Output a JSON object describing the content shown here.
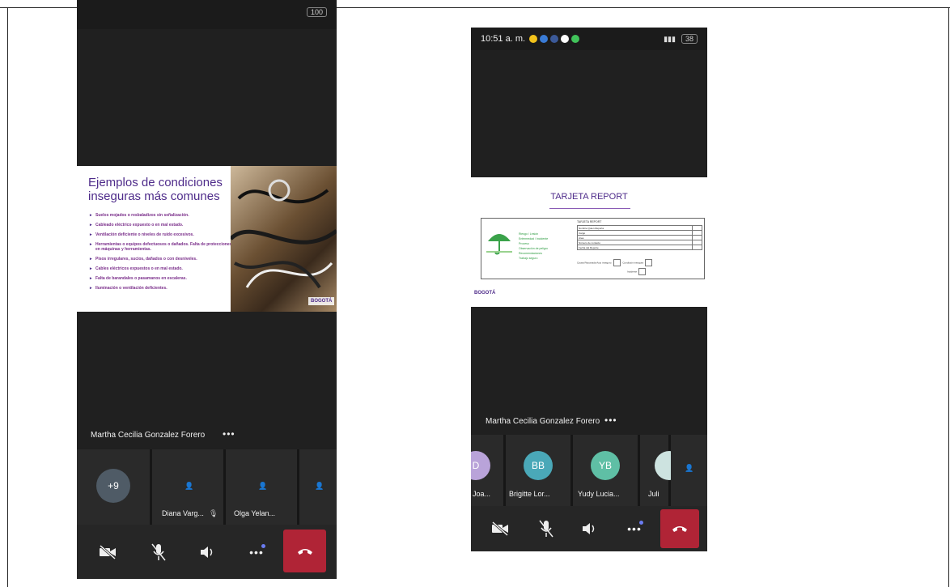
{
  "phone1": {
    "status_battery": "100",
    "slide": {
      "title": "Ejemplos de condiciones inseguras más comunes",
      "bullets": [
        "Suelos mojados o resbaladizos sin señalización.",
        "Cableado eléctrico expuesto o en mal estado.",
        "Ventilación deficiente o niveles de ruido excesivos.",
        "Herramientas o equipos defectuosos o dañados. Falta de protecciones en máquinas y herramientas.",
        "Pisos irregulares, sucios, dañados o con desniveles.",
        "Cables eléctricos expuestos o en mal estado.",
        "Falta de barandales o pasamanos en escaleras.",
        "Iluminación o ventilación deficientes."
      ],
      "logo": "BOGOTÁ"
    },
    "speaker": "Martha Cecilia Gonzalez Forero",
    "more": "•••",
    "participants": {
      "overflow_count": "+9",
      "tiles": [
        {
          "label": "Diana Varg..."
        },
        {
          "label": "Olga Yelan..."
        }
      ]
    }
  },
  "phone2": {
    "status_time": "10:51 a. m.",
    "status_battery": "38",
    "slide": {
      "title": "TARJETA REPORT",
      "form_header": "TARJETA REPORT",
      "form_list": [
        "Riesgo / Lesión",
        "Enfermedad / Incidente",
        "Proceso",
        "Observación de peligro",
        "Recomendaciones",
        "Trabajo seguro"
      ],
      "form_rows": [
        "Nombre Quien Reporta",
        "Cargo",
        "Área",
        "Número de contacto",
        "Fecha del Reporte"
      ],
      "check_label": "Causa Reportada",
      "check_options": [
        "Acto inseguro",
        "Condición insegura",
        "Incidente"
      ],
      "logo": "BOGOTÁ"
    },
    "speaker": "Martha Cecilia Gonzalez Forero",
    "more": "•••",
    "participants": [
      {
        "initials": "D",
        "label": "Joa...",
        "color": "#b9a3d9"
      },
      {
        "initials": "BB",
        "label": "Brigitte Lor...",
        "color": "#4aa8b8"
      },
      {
        "initials": "YB",
        "label": "Yudy Lucia...",
        "color": "#5fbfa5"
      },
      {
        "initials": "",
        "label": "Juli",
        "color": "#cde3e0"
      }
    ]
  },
  "colors": {
    "end_call": "#b02436",
    "slide_title": "#4e2b8a",
    "phone_bg": "#202020"
  }
}
